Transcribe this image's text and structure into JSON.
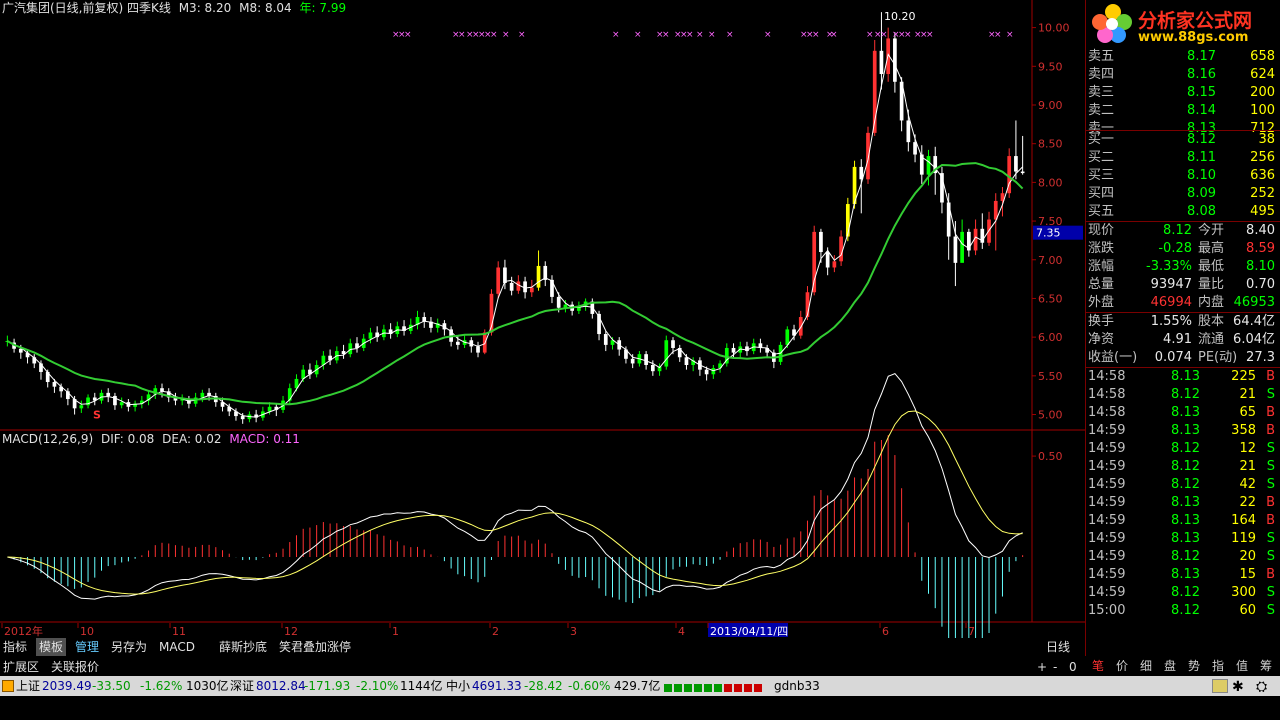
{
  "header": {
    "title": "广汽集团(日线,前复权) 四季K线",
    "m3": "M3: 8.20",
    "m8": "M8: 8.04",
    "year": "年: 7.99"
  },
  "chart_data": {
    "type": "candlestick",
    "y_ticks": [
      "10.00",
      "9.50",
      "9.00",
      "8.50",
      "8.00",
      "7.50",
      "7.00",
      "6.50",
      "6.00",
      "5.50",
      "5.00"
    ],
    "y_range": [
      4.8,
      10.15
    ],
    "price_marker": "7.35",
    "peak_label": "10.20",
    "s_marker": "S",
    "x_labels": [
      "2012年",
      "10",
      "11",
      "12",
      "1",
      "2",
      "3",
      "4",
      "2013/04/11/四",
      "6",
      "7"
    ],
    "cursor_date": "2013/04/11/四",
    "candles": [
      [
        5.95,
        5.95,
        6.02,
        5.88
      ],
      [
        5.93,
        5.85,
        5.98,
        5.8
      ],
      [
        5.85,
        5.8,
        5.9,
        5.72
      ],
      [
        5.8,
        5.74,
        5.84,
        5.66
      ],
      [
        5.74,
        5.66,
        5.78,
        5.6
      ],
      [
        5.66,
        5.55,
        5.7,
        5.45
      ],
      [
        5.55,
        5.42,
        5.58,
        5.35
      ],
      [
        5.42,
        5.36,
        5.46,
        5.28
      ],
      [
        5.36,
        5.3,
        5.4,
        5.22
      ],
      [
        5.3,
        5.2,
        5.34,
        5.12
      ],
      [
        5.2,
        5.08,
        5.24,
        5.0
      ],
      [
        5.08,
        5.12,
        5.18,
        5.02
      ],
      [
        5.12,
        5.22,
        5.26,
        5.08
      ],
      [
        5.22,
        5.18,
        5.28,
        5.12
      ],
      [
        5.18,
        5.28,
        5.32,
        5.14
      ],
      [
        5.28,
        5.24,
        5.34,
        5.16
      ],
      [
        5.24,
        5.12,
        5.28,
        5.06
      ],
      [
        5.12,
        5.16,
        5.22,
        5.08
      ],
      [
        5.16,
        5.1,
        5.2,
        5.04
      ],
      [
        5.1,
        5.14,
        5.18,
        5.04
      ],
      [
        5.14,
        5.18,
        5.24,
        5.08
      ],
      [
        5.18,
        5.26,
        5.3,
        5.12
      ],
      [
        5.26,
        5.34,
        5.38,
        5.2
      ],
      [
        5.34,
        5.3,
        5.4,
        5.22
      ],
      [
        5.3,
        5.22,
        5.34,
        5.16
      ],
      [
        5.22,
        5.18,
        5.28,
        5.12
      ],
      [
        5.18,
        5.2,
        5.26,
        5.12
      ],
      [
        5.2,
        5.14,
        5.24,
        5.08
      ],
      [
        5.14,
        5.22,
        5.28,
        5.1
      ],
      [
        5.22,
        5.28,
        5.32,
        5.16
      ],
      [
        5.28,
        5.24,
        5.34,
        5.18
      ],
      [
        5.24,
        5.16,
        5.28,
        5.1
      ],
      [
        5.16,
        5.1,
        5.22,
        5.04
      ],
      [
        5.1,
        5.04,
        5.14,
        4.98
      ],
      [
        5.04,
        4.98,
        5.08,
        4.92
      ],
      [
        4.98,
        4.94,
        5.02,
        4.88
      ],
      [
        4.94,
        5.0,
        5.04,
        4.9
      ],
      [
        5.0,
        4.96,
        5.06,
        4.9
      ],
      [
        4.96,
        5.04,
        5.1,
        4.92
      ],
      [
        5.04,
        5.1,
        5.16,
        5.0
      ],
      [
        5.1,
        5.06,
        5.14,
        4.98
      ],
      [
        5.06,
        5.18,
        5.24,
        5.02
      ],
      [
        5.18,
        5.34,
        5.4,
        5.14
      ],
      [
        5.34,
        5.46,
        5.52,
        5.3
      ],
      [
        5.46,
        5.58,
        5.64,
        5.42
      ],
      [
        5.58,
        5.52,
        5.66,
        5.46
      ],
      [
        5.52,
        5.64,
        5.7,
        5.48
      ],
      [
        5.64,
        5.76,
        5.82,
        5.58
      ],
      [
        5.76,
        5.7,
        5.84,
        5.64
      ],
      [
        5.7,
        5.82,
        5.88,
        5.66
      ],
      [
        5.82,
        5.78,
        5.9,
        5.72
      ],
      [
        5.78,
        5.92,
        5.98,
        5.74
      ],
      [
        5.92,
        5.86,
        6.0,
        5.8
      ],
      [
        5.86,
        5.98,
        6.04,
        5.82
      ],
      [
        5.98,
        6.06,
        6.12,
        5.92
      ],
      [
        6.06,
        6.0,
        6.14,
        5.94
      ],
      [
        6.0,
        6.1,
        6.16,
        5.96
      ],
      [
        6.1,
        6.04,
        6.18,
        5.98
      ],
      [
        6.04,
        6.14,
        6.2,
        6.0
      ],
      [
        6.14,
        6.08,
        6.22,
        6.02
      ],
      [
        6.08,
        6.16,
        6.24,
        6.04
      ],
      [
        6.16,
        6.26,
        6.34,
        6.1
      ],
      [
        6.26,
        6.2,
        6.32,
        6.12
      ],
      [
        6.2,
        6.12,
        6.26,
        6.06
      ],
      [
        6.12,
        6.18,
        6.24,
        6.06
      ],
      [
        6.18,
        6.1,
        6.22,
        6.02
      ],
      [
        6.1,
        5.94,
        6.14,
        5.88
      ],
      [
        5.94,
        5.9,
        6.02,
        5.84
      ],
      [
        5.9,
        5.96,
        6.02,
        5.86
      ],
      [
        5.96,
        5.88,
        6.0,
        5.8
      ],
      [
        5.88,
        5.8,
        5.94,
        5.74
      ],
      [
        5.8,
        6.06,
        6.1,
        5.78
      ],
      [
        6.06,
        6.56,
        6.62,
        6.02
      ],
      [
        6.56,
        6.9,
        6.98,
        6.5
      ],
      [
        6.9,
        6.7,
        7.0,
        6.62
      ],
      [
        6.7,
        6.6,
        6.78,
        6.54
      ],
      [
        6.6,
        6.72,
        6.8,
        6.56
      ],
      [
        6.72,
        6.58,
        6.78,
        6.5
      ],
      [
        6.58,
        6.64,
        6.74,
        6.52
      ],
      [
        6.64,
        6.92,
        7.12,
        6.6
      ],
      [
        6.92,
        6.74,
        6.98,
        6.66
      ],
      [
        6.74,
        6.52,
        6.8,
        6.44
      ],
      [
        6.52,
        6.38,
        6.58,
        6.32
      ],
      [
        6.38,
        6.42,
        6.48,
        6.32
      ],
      [
        6.42,
        6.34,
        6.46,
        6.28
      ],
      [
        6.34,
        6.4,
        6.46,
        6.3
      ],
      [
        6.4,
        6.46,
        6.5,
        6.34
      ],
      [
        6.46,
        6.3,
        6.5,
        6.24
      ],
      [
        6.3,
        6.04,
        6.34,
        5.96
      ],
      [
        6.04,
        5.9,
        6.08,
        5.82
      ],
      [
        5.9,
        5.96,
        6.0,
        5.84
      ],
      [
        5.96,
        5.84,
        6.0,
        5.76
      ],
      [
        5.84,
        5.72,
        5.88,
        5.66
      ],
      [
        5.72,
        5.66,
        5.78,
        5.6
      ],
      [
        5.66,
        5.78,
        5.82,
        5.62
      ],
      [
        5.78,
        5.64,
        5.82,
        5.58
      ],
      [
        5.64,
        5.56,
        5.7,
        5.5
      ],
      [
        5.56,
        5.62,
        5.66,
        5.5
      ],
      [
        5.62,
        5.96,
        6.02,
        5.58
      ],
      [
        5.96,
        5.86,
        6.0,
        5.78
      ],
      [
        5.86,
        5.74,
        5.9,
        5.68
      ],
      [
        5.74,
        5.64,
        5.78,
        5.58
      ],
      [
        5.64,
        5.7,
        5.74,
        5.56
      ],
      [
        5.7,
        5.58,
        5.74,
        5.5
      ],
      [
        5.58,
        5.52,
        5.62,
        5.44
      ],
      [
        5.52,
        5.6,
        5.64,
        5.46
      ],
      [
        5.6,
        5.66,
        5.7,
        5.54
      ],
      [
        5.66,
        5.86,
        5.92,
        5.62
      ],
      [
        5.86,
        5.8,
        5.92,
        5.74
      ],
      [
        5.8,
        5.88,
        5.94,
        5.74
      ],
      [
        5.88,
        5.82,
        5.94,
        5.76
      ],
      [
        5.82,
        5.92,
        5.98,
        5.78
      ],
      [
        5.92,
        5.86,
        5.98,
        5.8
      ],
      [
        5.86,
        5.8,
        5.9,
        5.74
      ],
      [
        5.8,
        5.68,
        5.84,
        5.6
      ],
      [
        5.68,
        5.9,
        5.94,
        5.64
      ],
      [
        5.9,
        6.1,
        6.14,
        5.86
      ],
      [
        6.1,
        6.02,
        6.16,
        5.96
      ],
      [
        6.02,
        6.26,
        6.34,
        5.98
      ],
      [
        6.26,
        6.58,
        6.66,
        6.22
      ],
      [
        6.58,
        7.36,
        7.44,
        6.54
      ],
      [
        7.36,
        7.1,
        7.4,
        6.96
      ],
      [
        7.1,
        6.9,
        7.16,
        6.8
      ],
      [
        6.9,
        6.98,
        7.06,
        6.84
      ],
      [
        6.98,
        7.3,
        7.38,
        6.92
      ],
      [
        7.3,
        7.72,
        7.8,
        7.24
      ],
      [
        7.72,
        8.2,
        8.28,
        7.66
      ],
      [
        8.2,
        8.04,
        8.3,
        7.6
      ],
      [
        8.04,
        8.64,
        8.72,
        7.98
      ],
      [
        8.64,
        9.7,
        9.84,
        8.6
      ],
      [
        9.7,
        9.4,
        10.2,
        9.2
      ],
      [
        9.4,
        9.86,
        10.0,
        9.3
      ],
      [
        9.86,
        9.3,
        9.94,
        9.16
      ],
      [
        9.3,
        8.8,
        9.36,
        8.66
      ],
      [
        8.8,
        8.52,
        8.94,
        8.4
      ],
      [
        8.52,
        8.36,
        8.62,
        8.26
      ],
      [
        8.36,
        8.1,
        8.48,
        7.98
      ],
      [
        8.1,
        8.34,
        8.42,
        7.96
      ],
      [
        8.34,
        8.12,
        8.46,
        7.84
      ],
      [
        8.12,
        7.74,
        8.2,
        7.6
      ],
      [
        7.74,
        7.3,
        7.86,
        7.0
      ],
      [
        7.3,
        6.96,
        7.5,
        6.66
      ],
      [
        6.96,
        7.36,
        7.52,
        7.0
      ],
      [
        7.36,
        7.12,
        7.4,
        7.04
      ],
      [
        7.12,
        7.4,
        7.52,
        7.06
      ],
      [
        7.4,
        7.22,
        7.6,
        7.14
      ],
      [
        7.22,
        7.52,
        7.62,
        7.18
      ],
      [
        7.52,
        7.76,
        7.86,
        7.12
      ],
      [
        7.76,
        7.86,
        7.94,
        7.56
      ],
      [
        7.86,
        8.34,
        8.44,
        7.8
      ],
      [
        8.34,
        8.14,
        8.8,
        8.04
      ],
      [
        8.14,
        8.12,
        8.6,
        8.1
      ]
    ],
    "macd_label": "MACD(12,26,9)",
    "dif_label": "DIF: 0.08",
    "dea_label": "DEA: 0.02",
    "macd_value_label": "MACD: 0.11",
    "macd_tick": "0.50"
  },
  "quote": {
    "sell": [
      {
        "label": "卖五",
        "price": "8.17",
        "vol": "658"
      },
      {
        "label": "卖四",
        "price": "8.16",
        "vol": "624"
      },
      {
        "label": "卖三",
        "price": "8.15",
        "vol": "200"
      },
      {
        "label": "卖二",
        "price": "8.14",
        "vol": "100"
      },
      {
        "label": "卖一",
        "price": "8.13",
        "vol": "712"
      }
    ],
    "buy": [
      {
        "label": "买一",
        "price": "8.12",
        "vol": "38"
      },
      {
        "label": "买二",
        "price": "8.11",
        "vol": "256"
      },
      {
        "label": "买三",
        "price": "8.10",
        "vol": "636"
      },
      {
        "label": "买四",
        "price": "8.09",
        "vol": "252"
      },
      {
        "label": "买五",
        "price": "8.08",
        "vol": "495"
      }
    ],
    "stats": [
      {
        "l1": "现价",
        "v1": "8.12",
        "l2": "今开",
        "v2": "8.40",
        "c1": "green",
        "c2": "white"
      },
      {
        "l1": "涨跌",
        "v1": "-0.28",
        "l2": "最高",
        "v2": "8.59",
        "c1": "green",
        "c2": "red"
      },
      {
        "l1": "涨幅",
        "v1": "-3.33%",
        "l2": "最低",
        "v2": "8.10",
        "c1": "green",
        "c2": "green"
      },
      {
        "l1": "总量",
        "v1": "93947",
        "l2": "量比",
        "v2": "0.70",
        "c1": "white",
        "c2": "white"
      },
      {
        "l1": "外盘",
        "v1": "46994",
        "l2": "内盘",
        "v2": "46953",
        "c1": "red",
        "c2": "green"
      }
    ],
    "stats2": [
      {
        "l1": "换手",
        "v1": "1.55%",
        "l2": "股本",
        "v2": "64.4亿"
      },
      {
        "l1": "净资",
        "v1": "4.91",
        "l2": "流通",
        "v2": "6.04亿"
      },
      {
        "l1": "收益(一)",
        "v1": "0.074",
        "l2": "PE(动)",
        "v2": "27.3"
      }
    ],
    "ticks": [
      {
        "time": "14:58",
        "price": "8.13",
        "vol": "225",
        "bs": "B"
      },
      {
        "time": "14:58",
        "price": "8.12",
        "vol": "21",
        "bs": "S"
      },
      {
        "time": "14:58",
        "price": "8.13",
        "vol": "65",
        "bs": "B"
      },
      {
        "time": "14:59",
        "price": "8.13",
        "vol": "358",
        "bs": "B"
      },
      {
        "time": "14:59",
        "price": "8.12",
        "vol": "12",
        "bs": "S"
      },
      {
        "time": "14:59",
        "price": "8.12",
        "vol": "21",
        "bs": "S"
      },
      {
        "time": "14:59",
        "price": "8.12",
        "vol": "42",
        "bs": "S"
      },
      {
        "time": "14:59",
        "price": "8.13",
        "vol": "22",
        "bs": "B"
      },
      {
        "time": "14:59",
        "price": "8.13",
        "vol": "164",
        "bs": "B"
      },
      {
        "time": "14:59",
        "price": "8.13",
        "vol": "119",
        "bs": "S"
      },
      {
        "time": "14:59",
        "price": "8.12",
        "vol": "20",
        "bs": "S"
      },
      {
        "time": "14:59",
        "price": "8.13",
        "vol": "15",
        "bs": "B"
      },
      {
        "time": "14:59",
        "price": "8.12",
        "vol": "300",
        "bs": "S"
      },
      {
        "time": "15:00",
        "price": "8.12",
        "vol": "60",
        "bs": "S"
      }
    ]
  },
  "logo": {
    "text": "分析家公式网",
    "url": "www.88gs.com"
  },
  "bottom_tabs": [
    "指标",
    "模板",
    "管理",
    "另存为",
    "MACD",
    "薛斯抄底",
    "笑君叠加涨停"
  ],
  "bottom_tabs2": [
    "扩展区",
    "关联报价"
  ],
  "period_label": "日线",
  "zoom_controls": [
    "+",
    "-",
    "0"
  ],
  "side_tabs": [
    "笔",
    "价",
    "细",
    "盘",
    "势",
    "指",
    "值",
    "筹"
  ],
  "status": {
    "sh_label": "上证",
    "sh_val": "2039.49",
    "sh_chg": "-33.50",
    "sh_pct": "-1.62%",
    "sh_amt": "1030亿",
    "sz_label": "深证",
    "sz_val": "8012.84",
    "sz_chg": "-171.93",
    "sz_pct": "-2.10%",
    "sz_amt": "1144亿",
    "zx_label": "中小",
    "zx_val": "4691.33",
    "zx_chg": "-28.42",
    "zx_pct": "-0.60%",
    "zx_amt": "429.7亿",
    "user": "gdnb33"
  },
  "colors": {
    "up": "#ff3232",
    "down": "#00ff00",
    "flat": "#ffffff",
    "ma_fast": "#ffffff",
    "ma_slow": "#33cc33",
    "year": "#00ff00",
    "macd": "#ff66ff"
  }
}
